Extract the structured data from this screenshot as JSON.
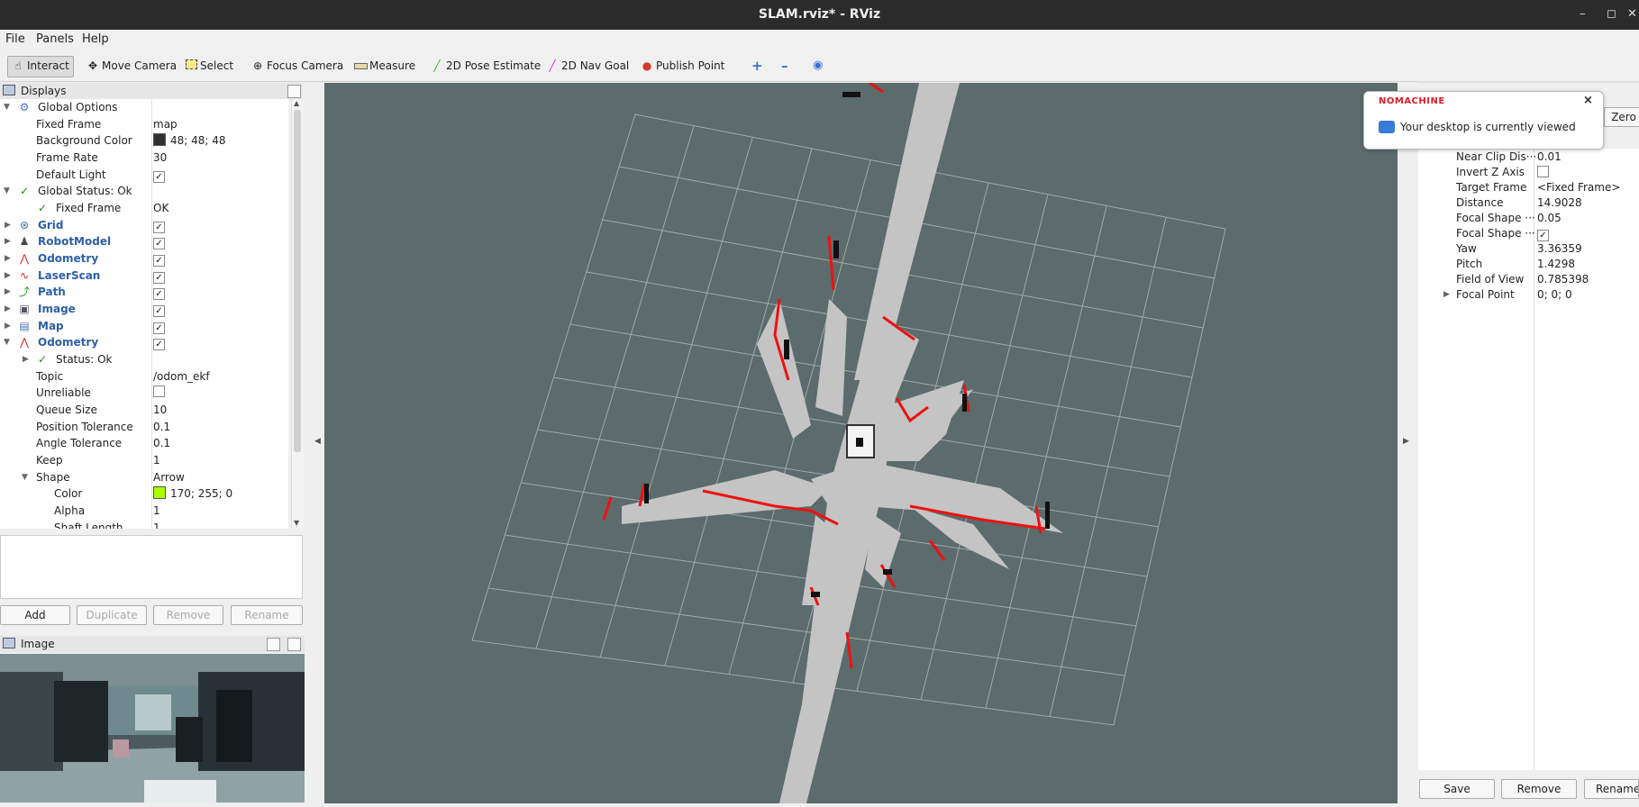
{
  "window": {
    "title": "SLAM.rviz* - RViz",
    "controls": [
      "–",
      "◻",
      "✕"
    ]
  },
  "menu": [
    "File",
    "Panels",
    "Help"
  ],
  "toolbar": {
    "interact": "Interact",
    "move_camera": "Move Camera",
    "select": "Select",
    "focus_camera": "Focus Camera",
    "measure": "Measure",
    "pose_estimate": "2D Pose Estimate",
    "nav_goal": "2D Nav Goal",
    "publish_point": "Publish Point"
  },
  "displays": {
    "title": "Displays",
    "rows": [
      {
        "name": "Global Options",
        "value": ""
      },
      {
        "name": "Fixed Frame",
        "value": "map"
      },
      {
        "name": "Background Color",
        "value": "48; 48; 48",
        "color": "#303030"
      },
      {
        "name": "Frame Rate",
        "value": "30"
      },
      {
        "name": "Default Light",
        "value": "",
        "checked": true
      },
      {
        "name": "Global Status: Ok",
        "value": ""
      },
      {
        "name": "Fixed Frame",
        "value": "OK"
      },
      {
        "name": "Grid",
        "value": "",
        "checked": true
      },
      {
        "name": "RobotModel",
        "value": "",
        "checked": true
      },
      {
        "name": "Odometry",
        "value": "",
        "checked": true
      },
      {
        "name": "LaserScan",
        "value": "",
        "checked": true
      },
      {
        "name": "Path",
        "value": "",
        "checked": true
      },
      {
        "name": "Image",
        "value": "",
        "checked": true
      },
      {
        "name": "Map",
        "value": "",
        "checked": true
      },
      {
        "name": "Odometry",
        "value": "",
        "checked": true
      },
      {
        "name": "Status: Ok",
        "value": ""
      },
      {
        "name": "Topic",
        "value": "/odom_ekf"
      },
      {
        "name": "Unreliable",
        "value": "",
        "checked": false
      },
      {
        "name": "Queue Size",
        "value": "10"
      },
      {
        "name": "Position Tolerance",
        "value": "0.1"
      },
      {
        "name": "Angle Tolerance",
        "value": "0.1"
      },
      {
        "name": "Keep",
        "value": "1"
      },
      {
        "name": "Shape",
        "value": "Arrow"
      },
      {
        "name": "Color",
        "value": "170; 255; 0",
        "color": "#aaff00"
      },
      {
        "name": "Alpha",
        "value": "1"
      },
      {
        "name": "Shaft Length",
        "value": "1"
      }
    ],
    "buttons": {
      "add": "Add",
      "duplicate": "Duplicate",
      "remove": "Remove",
      "rename": "Rename"
    }
  },
  "image_panel": {
    "title": "Image"
  },
  "views": {
    "zero_button": "Zero",
    "rows": [
      {
        "name": "Near Clip Dis···",
        "value": "0.01"
      },
      {
        "name": "Invert Z Axis",
        "value": "",
        "checked": false
      },
      {
        "name": "Target Frame",
        "value": "<Fixed Frame>"
      },
      {
        "name": "Distance",
        "value": "14.9028"
      },
      {
        "name": "Focal Shape ···",
        "value": "0.05"
      },
      {
        "name": "Focal Shape ···",
        "value": "",
        "checked": true
      },
      {
        "name": "Yaw",
        "value": "3.36359"
      },
      {
        "name": "Pitch",
        "value": "1.4298"
      },
      {
        "name": "Field of View",
        "value": "0.785398"
      },
      {
        "name": "Focal Point",
        "value": "0; 0; 0"
      }
    ],
    "buttons": {
      "save": "Save",
      "remove": "Remove",
      "rename": "Rename"
    }
  },
  "notification": {
    "brand": "NOMACHINE",
    "message": "Your desktop is currently viewed"
  }
}
